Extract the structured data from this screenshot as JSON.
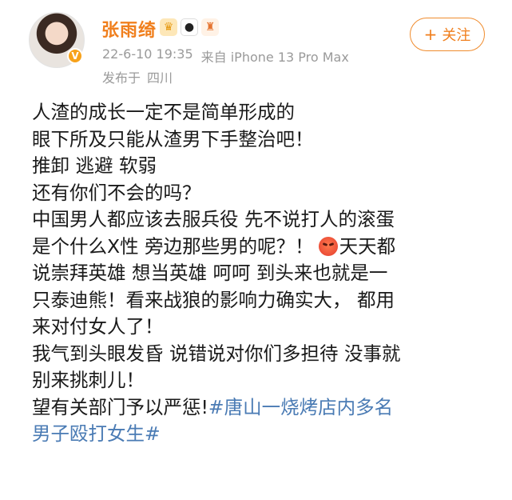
{
  "user": {
    "name": "张雨绮",
    "vip_badge": "V",
    "badges": [
      "crown-badge-icon",
      "panda-badge-icon",
      "chair-badge-icon"
    ]
  },
  "meta": {
    "time": "22-6-10 19:35",
    "source": "来自 iPhone 13 Pro Max",
    "location_label": "发布于",
    "location": "四川"
  },
  "follow": {
    "plus": "+",
    "label": "关注"
  },
  "post": {
    "lines": [
      "人渣的成长一定不是简单形成的",
      "眼下所及只能从渣男下手整治吧！",
      "推卸 逃避 软弱",
      "还有你们不会的吗？",
      "中国男人都应该去服兵役 先不说打人的滚蛋",
      "是个什么X性 旁边那些男的呢？！",
      "天天都",
      "说崇拜英雄 想当英雄 呵呵 到头来也就是一",
      "只泰迪熊！看来战狼的影响力确实大， 都用",
      "来对付女人了！",
      "我气到头眼发昏 说错说对你们多担待 没事就",
      "别来挑刺儿！",
      "望有关部门予以严惩!"
    ],
    "hashtag_line1": "#唐山一烧烤店内多名",
    "hashtag_line2": "男子殴打女生#",
    "colors": {
      "hashtag": "#4a7bb4",
      "name": "#f07f1d"
    }
  }
}
